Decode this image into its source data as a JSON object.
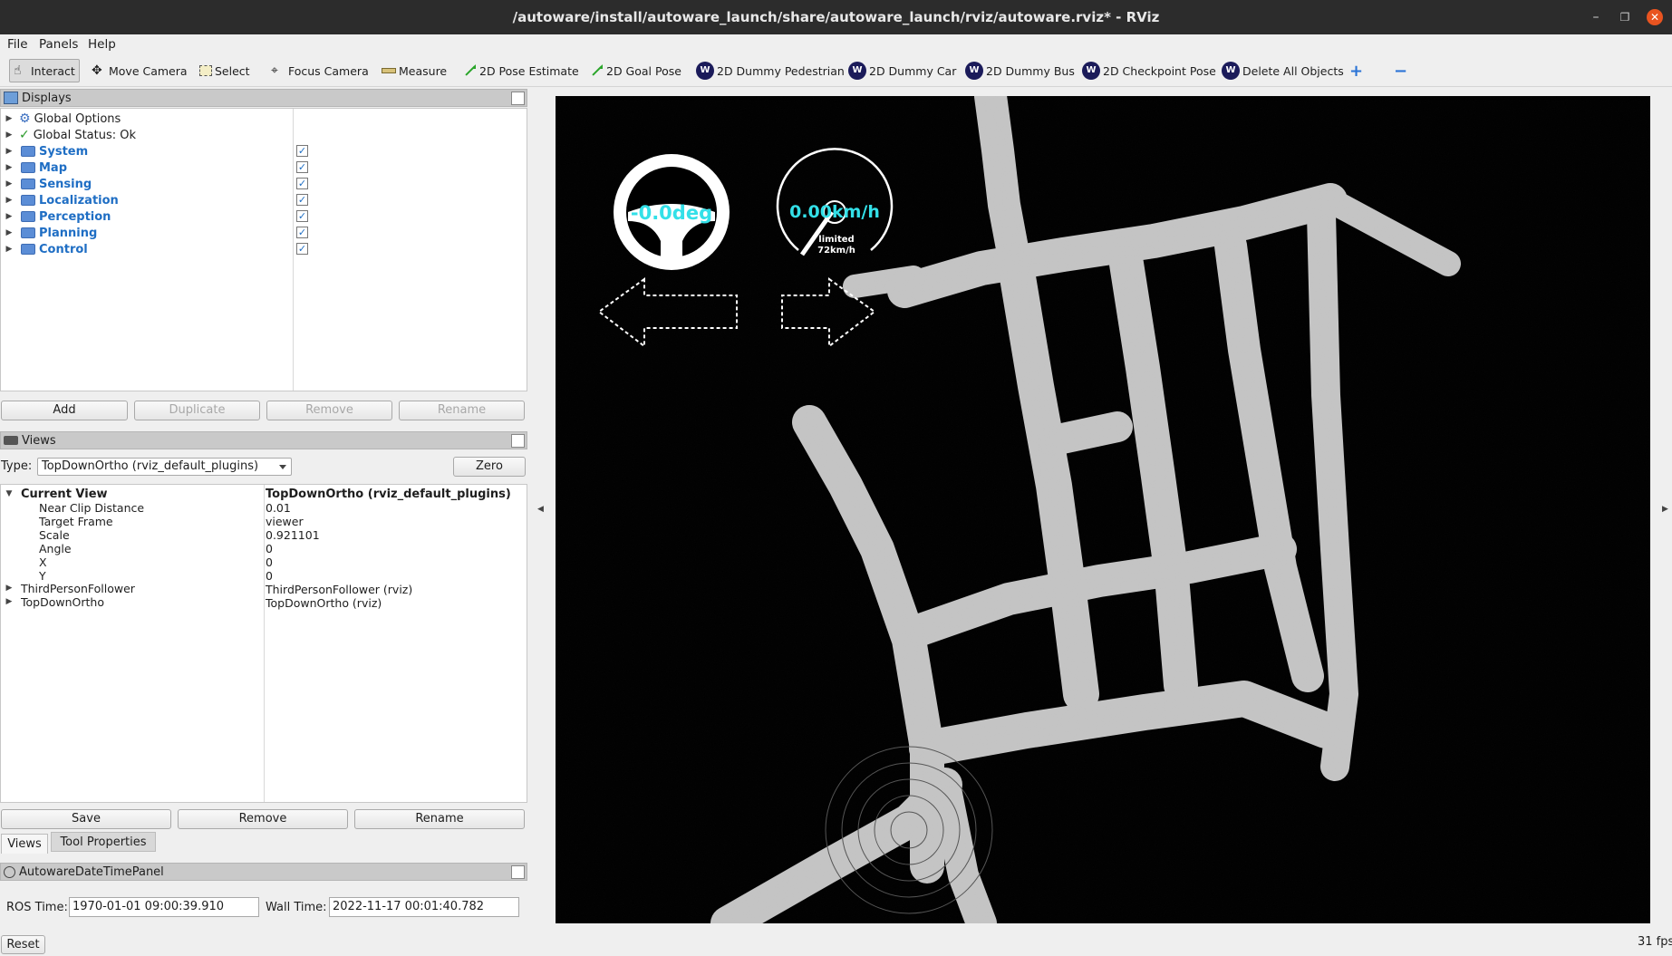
{
  "window": {
    "title": "/autoware/install/autoware_launch/share/autoware_launch/rviz/autoware.rviz* - RViz"
  },
  "menu": [
    "File",
    "Panels",
    "Help"
  ],
  "toolbar": {
    "interact": "Interact",
    "move_camera": "Move Camera",
    "select": "Select",
    "focus_camera": "Focus Camera",
    "measure": "Measure",
    "pose_estimate": "2D Pose Estimate",
    "goal_pose": "2D Goal Pose",
    "dummy_pedestrian": "2D Dummy Pedestrian",
    "dummy_car": "2D Dummy Car",
    "dummy_bus": "2D Dummy Bus",
    "checkpoint_pose": "2D Checkpoint Pose",
    "delete_all": "Delete All Objects"
  },
  "displays": {
    "header": "Displays",
    "items": [
      {
        "label": "Global Options",
        "bold": false,
        "checked": null
      },
      {
        "label": "Global Status: Ok",
        "bold": false,
        "checked": null
      },
      {
        "label": "System",
        "bold": true,
        "checked": true
      },
      {
        "label": "Map",
        "bold": true,
        "checked": true
      },
      {
        "label": "Sensing",
        "bold": true,
        "checked": true
      },
      {
        "label": "Localization",
        "bold": true,
        "checked": true
      },
      {
        "label": "Perception",
        "bold": true,
        "checked": true
      },
      {
        "label": "Planning",
        "bold": true,
        "checked": true
      },
      {
        "label": "Control",
        "bold": true,
        "checked": true
      }
    ],
    "buttons": {
      "add": "Add",
      "duplicate": "Duplicate",
      "remove": "Remove",
      "rename": "Rename"
    }
  },
  "views": {
    "header": "Views",
    "type_label": "Type:",
    "type_value": "TopDownOrtho (rviz_default_plugins)",
    "zero": "Zero",
    "current_view": {
      "label": "Current View",
      "value": "TopDownOrtho (rviz_default_plugins)"
    },
    "props": [
      {
        "name": "Near Clip Distance",
        "value": "0.01"
      },
      {
        "name": "Target Frame",
        "value": "viewer"
      },
      {
        "name": "Scale",
        "value": "0.921101"
      },
      {
        "name": "Angle",
        "value": "0"
      },
      {
        "name": "X",
        "value": "0"
      },
      {
        "name": "Y",
        "value": "0"
      }
    ],
    "saved": [
      {
        "name": "ThirdPersonFollower",
        "value": "ThirdPersonFollower (rviz)"
      },
      {
        "name": "TopDownOrtho",
        "value": "TopDownOrtho (rviz)"
      }
    ],
    "buttons": {
      "save": "Save",
      "remove": "Remove",
      "rename": "Rename"
    }
  },
  "tabs": {
    "views": "Views",
    "tool_properties": "Tool Properties"
  },
  "datetime": {
    "header": "AutowareDateTimePanel",
    "ros_label": "ROS Time:",
    "ros_value": "1970-01-01 09:00:39.910",
    "wall_label": "Wall Time:",
    "wall_value": "2022-11-17 00:01:40.782"
  },
  "reset": "Reset",
  "fps": "31 fps",
  "overlay": {
    "steering": "-0.0deg",
    "speed": "0.00km/h",
    "limit_line1": "limited",
    "limit_line2": "72km/h"
  },
  "colors": {
    "accent_cyan": "#33e0e8",
    "folder_blue": "#5b8dd6",
    "label_blue": "#1f6ec4"
  }
}
